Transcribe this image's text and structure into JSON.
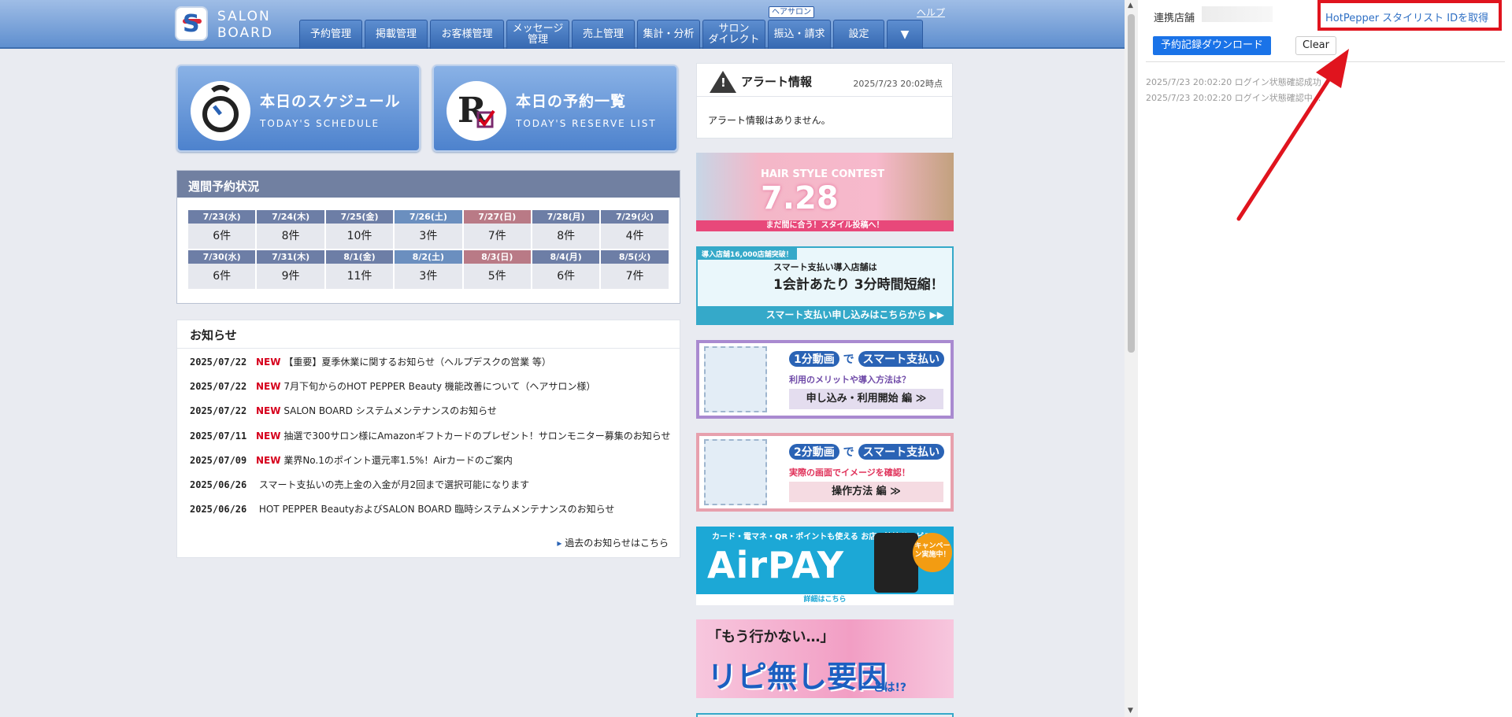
{
  "logo": {
    "mark": "S",
    "line1": "SALON",
    "line2": "BOARD"
  },
  "nav": {
    "items": [
      {
        "label": "予約管理",
        "width": 80
      },
      {
        "label": "掲載管理",
        "width": 80
      },
      {
        "label": "お客様管理",
        "width": 94
      },
      {
        "label": "メッセージ\n管理",
        "width": 80
      },
      {
        "label": "売上管理",
        "width": 80
      },
      {
        "label": "集計・分析",
        "width": 80
      },
      {
        "label": "サロン\nダイレクト",
        "width": 80
      },
      {
        "label": "振込・請求",
        "width": 80
      },
      {
        "label": "設定",
        "width": 65
      }
    ],
    "more_icon": "▼",
    "badge": "ヘアサロン",
    "help": "ヘルプ"
  },
  "tiles": {
    "schedule": {
      "title": "本日のスケジュール",
      "sub": "TODAY'S SCHEDULE"
    },
    "reserve": {
      "title": "本日の予約一覧",
      "sub": "TODAY'S RESERVE LIST"
    }
  },
  "weekly": {
    "title": "週間予約状況",
    "rows": [
      [
        {
          "day": "7/23(水)",
          "count": "6件",
          "kind": "weekday"
        },
        {
          "day": "7/24(木)",
          "count": "8件",
          "kind": "weekday"
        },
        {
          "day": "7/25(金)",
          "count": "10件",
          "kind": "weekday"
        },
        {
          "day": "7/26(土)",
          "count": "3件",
          "kind": "sat"
        },
        {
          "day": "7/27(日)",
          "count": "7件",
          "kind": "sun"
        },
        {
          "day": "7/28(月)",
          "count": "8件",
          "kind": "weekday"
        },
        {
          "day": "7/29(火)",
          "count": "4件",
          "kind": "weekday"
        }
      ],
      [
        {
          "day": "7/30(水)",
          "count": "6件",
          "kind": "weekday"
        },
        {
          "day": "7/31(木)",
          "count": "9件",
          "kind": "weekday"
        },
        {
          "day": "8/1(金)",
          "count": "11件",
          "kind": "weekday"
        },
        {
          "day": "8/2(土)",
          "count": "3件",
          "kind": "sat"
        },
        {
          "day": "8/3(日)",
          "count": "5件",
          "kind": "sun"
        },
        {
          "day": "8/4(月)",
          "count": "6件",
          "kind": "weekday"
        },
        {
          "day": "8/5(火)",
          "count": "7件",
          "kind": "weekday"
        }
      ]
    ]
  },
  "news": {
    "title": "お知らせ",
    "items": [
      {
        "date": "2025/07/22",
        "new": "NEW",
        "text": "【重要】夏季休業に関するお知らせ（ヘルプデスクの営業 等）"
      },
      {
        "date": "2025/07/22",
        "new": "NEW",
        "text": "7月下旬からのHOT PEPPER Beauty 機能改善について（ヘアサロン様）"
      },
      {
        "date": "2025/07/22",
        "new": "NEW",
        "text": "SALON BOARD システムメンテナンスのお知らせ"
      },
      {
        "date": "2025/07/11",
        "new": "NEW",
        "text": "抽選で300サロン様にAmazonギフトカードのプレゼント！サロンモニター募集のお知らせ"
      },
      {
        "date": "2025/07/09",
        "new": "NEW",
        "text": "業界No.1のポイント還元率1.5%！Airカードのご案内"
      },
      {
        "date": "2025/06/26",
        "new": "",
        "text": "スマート支払いの売上金の入金が月2回まで選択可能になります"
      },
      {
        "date": "2025/06/26",
        "new": "",
        "text": "HOT PEPPER BeautyおよびSALON BOARD 臨時システムメンテナンスのお知らせ"
      }
    ],
    "more": "過去のお知らせはこちら"
  },
  "alert": {
    "title": "アラート情報",
    "time": "2025/7/23 20:02時点",
    "message": "アラート情報はありません。"
  },
  "banners": {
    "contest": {
      "label": "HAIR STYLE CONTEST",
      "big": "7.28",
      "bar": "まだ間に合う！スタイル投稿へ！"
    },
    "smartpay": {
      "top": "導入店舗16,000店舗突破！",
      "l1": "スマート支払い導入店舗は",
      "l2": "1会計あたり 3分時間短縮！",
      "bar": "スマート支払い申し込みはこちらから ▶▶"
    },
    "video1": {
      "pill1": "1分動画",
      "mid": "で",
      "pill2": "スマート支払い",
      "l2": "利用のメリットや導入方法は？",
      "btn": "申し込み・利用開始 編 ≫"
    },
    "video2": {
      "pill1": "2分動画",
      "mid": "で",
      "pill2": "スマート支払い",
      "l2": "実際の画面でイメージを確認！",
      "btn": "操作方法 編 ≫"
    },
    "airpay": {
      "l1": "カード・電マネ・QR・ポイントも使える お店の決済サービス",
      "big": "AirPAY",
      "camp": "キャンペーン実施中！",
      "foot": "詳細はこちら"
    },
    "manga": {
      "l1": "「もう行かない…」",
      "l2": "リピ無し要因",
      "l3": "とは!?"
    }
  },
  "panel": {
    "store_label": "連携店舗",
    "hp_link": "HotPepper スタイリスト IDを取得",
    "download": "予約記録ダウンロード",
    "clear": "Clear",
    "logs": [
      "2025/7/23 20:02:20 ログイン状態確認成功",
      "2025/7/23 20:02:20 ログイン状態確認中..."
    ],
    "arrow_color": "#e0141e"
  }
}
